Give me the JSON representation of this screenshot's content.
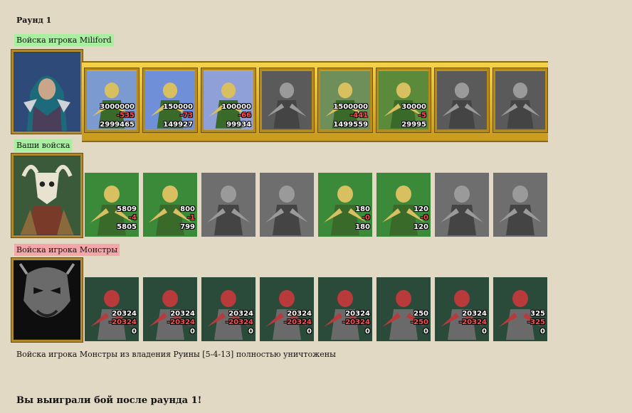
{
  "round_title": "Раунд 1",
  "groups": [
    {
      "label": "Войска игрока Miliford",
      "label_color": "#a8f0a0",
      "portrait": "hooded-mage-hero",
      "units": [
        {
          "name": "peasant-icon",
          "style": "color",
          "bg": "#7a9ad0",
          "total": "3000000",
          "loss": "-535",
          "left": "2999465"
        },
        {
          "name": "griffin-rider-icon",
          "style": "color",
          "bg": "#6f8fd8",
          "total": "150000",
          "loss": "-73",
          "left": "149927"
        },
        {
          "name": "cavalier-icon",
          "style": "color",
          "bg": "#8f9fd8",
          "total": "100000",
          "loss": "-66",
          "left": "99934"
        },
        {
          "name": "griffin-icon",
          "style": "gray",
          "bg": "#666",
          "total": "",
          "loss": "",
          "left": ""
        },
        {
          "name": "archer-icon",
          "style": "color",
          "bg": "#6f8f5a",
          "total": "1500000",
          "loss": "-441",
          "left": "1499559"
        },
        {
          "name": "monk-icon",
          "style": "color",
          "bg": "#5a8a3a",
          "total": "30000",
          "loss": "-5",
          "left": "29995"
        },
        {
          "name": "knight-icon",
          "style": "gray",
          "bg": "#555",
          "total": "",
          "loss": "",
          "left": ""
        },
        {
          "name": "priest-icon",
          "style": "gray",
          "bg": "#555",
          "total": "",
          "loss": "",
          "left": ""
        }
      ]
    },
    {
      "label": "Ваши войска",
      "label_color": "#a8f0a0",
      "portrait": "skull-helm-hero",
      "units": [
        {
          "name": "dwarf-icon",
          "style": "color",
          "bg": "#3a8a3a",
          "total": "5809",
          "loss": "-4",
          "left": "5805"
        },
        {
          "name": "blade-dancer-icon",
          "style": "color",
          "bg": "#3a8a3a",
          "total": "800",
          "loss": "-1",
          "left": "799"
        },
        {
          "name": "centaur-icon",
          "style": "gray",
          "bg": "#555",
          "total": "",
          "loss": "",
          "left": ""
        },
        {
          "name": "griffin-icon",
          "style": "gray",
          "bg": "#555",
          "total": "",
          "loss": "",
          "left": ""
        },
        {
          "name": "elf-archer-icon",
          "style": "color",
          "bg": "#3a8a3a",
          "total": "180",
          "loss": "-0",
          "left": "180"
        },
        {
          "name": "druid-icon",
          "style": "color",
          "bg": "#3a8a3a",
          "total": "120",
          "loss": "-0",
          "left": "120"
        },
        {
          "name": "treant-icon",
          "style": "gray",
          "bg": "#555",
          "total": "",
          "loss": "",
          "left": ""
        },
        {
          "name": "elder-druid-icon",
          "style": "gray",
          "bg": "#555",
          "total": "",
          "loss": "",
          "left": ""
        }
      ]
    },
    {
      "label": "Войска игрока Монстры",
      "label_color": "#f5a6a8",
      "portrait": "demon-mask",
      "units": [
        {
          "name": "lizard-icon",
          "style": "color",
          "bg": "#2a4a3a",
          "total": "20324",
          "loss": "-20324",
          "left": "0"
        },
        {
          "name": "golem-icon",
          "style": "color",
          "bg": "#2a4a3a",
          "total": "20324",
          "loss": "-20324",
          "left": "0"
        },
        {
          "name": "orc-icon",
          "style": "color",
          "bg": "#2a4a3a",
          "total": "20324",
          "loss": "-20324",
          "left": "0"
        },
        {
          "name": "demon-icon",
          "style": "color",
          "bg": "#2a4a3a",
          "total": "20324",
          "loss": "-20324",
          "left": "0"
        },
        {
          "name": "manticore-icon",
          "style": "color",
          "bg": "#2a4a3a",
          "total": "20324",
          "loss": "-20324",
          "left": "0"
        },
        {
          "name": "fire-demon-icon",
          "style": "color",
          "bg": "#2a4a3a",
          "total": "250",
          "loss": "-250",
          "left": "0"
        },
        {
          "name": "war-machine-icon",
          "style": "color",
          "bg": "#2a4a3a",
          "total": "20324",
          "loss": "-20324",
          "left": "0"
        },
        {
          "name": "naga-icon",
          "style": "color",
          "bg": "#2a4a3a",
          "total": "325",
          "loss": "-325",
          "left": "0"
        }
      ]
    }
  ],
  "message": "Войска игрока Монстры из владения Руины [5-4-13] полностью уничтожены",
  "final": "Вы выиграли бой после раунда 1!"
}
